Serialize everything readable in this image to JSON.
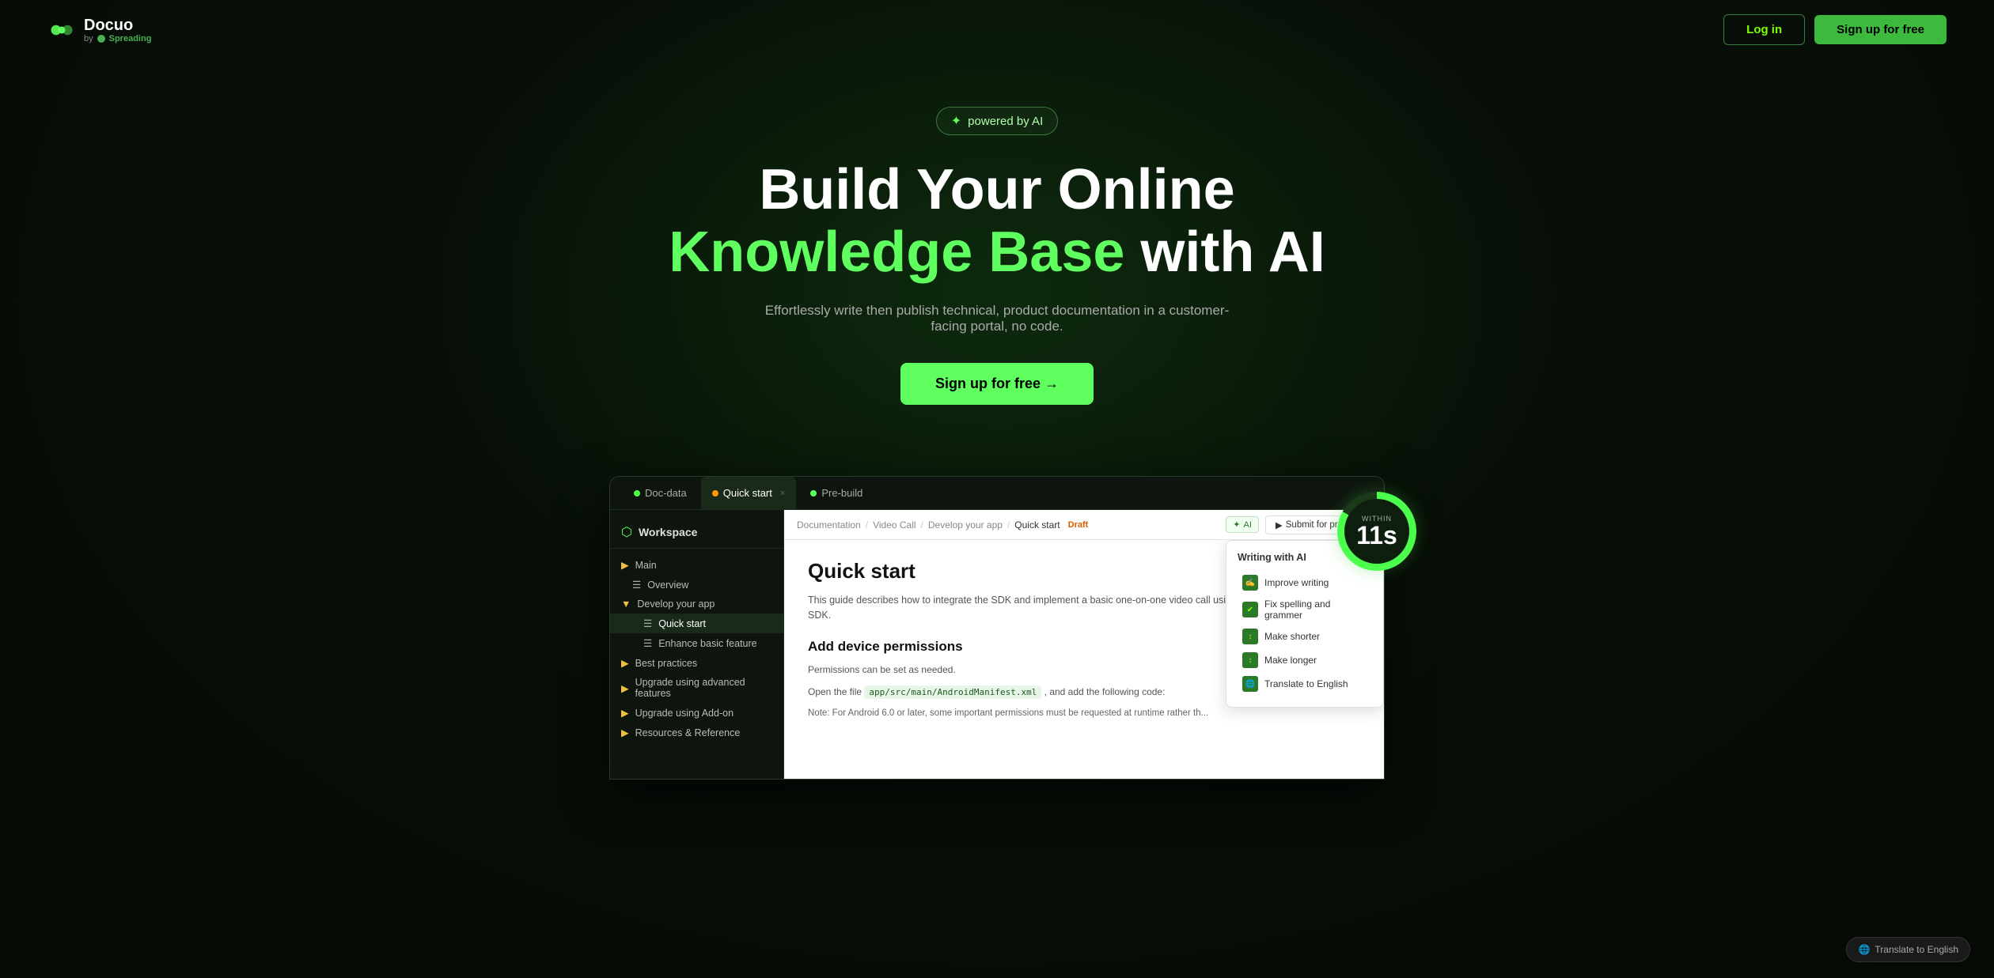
{
  "header": {
    "logo_name": "Docuo",
    "logo_by": "by",
    "logo_spreading": "Spreading",
    "login_label": "Log in",
    "signup_header_label": "Sign up for free"
  },
  "hero": {
    "ai_badge": "powered by AI",
    "title_part1": "Build Your Online ",
    "title_highlight": "Knowledge Base",
    "title_part2": " with AI",
    "subtitle": "Effortlessly write then publish technical, product documentation in a customer-facing portal, no code.",
    "signup_hero_label": "Sign up for free →"
  },
  "timer": {
    "within_label": "WITHIN",
    "seconds": "11s"
  },
  "app": {
    "tabs": [
      {
        "label": "Doc-data",
        "dot_color": "#4cff4c",
        "active": false
      },
      {
        "label": "Quick start",
        "dot_color": "#ff9900",
        "active": true,
        "closable": true
      },
      {
        "label": "Pre-build",
        "dot_color": "#5fff5f",
        "active": false
      }
    ],
    "sidebar": {
      "workspace_label": "Workspace",
      "items": [
        {
          "label": "Main",
          "type": "folder",
          "level": 0
        },
        {
          "label": "Overview",
          "type": "file",
          "level": 1
        },
        {
          "label": "Develop your app",
          "type": "folder",
          "level": 0,
          "expanded": true
        },
        {
          "label": "Quick start",
          "type": "file",
          "level": 2,
          "active": true
        },
        {
          "label": "Enhance basic feature",
          "type": "file",
          "level": 2
        },
        {
          "label": "Best practices",
          "type": "folder",
          "level": 0
        },
        {
          "label": "Upgrade using advanced features",
          "type": "folder",
          "level": 0
        },
        {
          "label": "Upgrade using Add-on",
          "type": "folder",
          "level": 0
        },
        {
          "label": "Resources & Reference",
          "type": "folder",
          "level": 0
        }
      ]
    },
    "breadcrumb": {
      "items": [
        "Documentation",
        "Video Call",
        "Develop your app",
        "Quick start"
      ],
      "draft_label": "Draft"
    },
    "toolbar": {
      "submit_preview_label": "Submit for preview",
      "ai_toolbar_label": "AI"
    },
    "content": {
      "title": "Quick start",
      "description": "This guide describes how to integrate the SDK and implement a basic one-on-one video call using ZEGOCLOUD's Video Call SDK.",
      "section1_title": "Add device permissions",
      "section1_text": "Permissions can be set as needed.",
      "section1_open_file": "Open the file",
      "section1_code": "app/src/main/AndroidManifest.xml",
      "section1_code_suffix": ", and add the following code:",
      "section1_note": "Note: For Android 6.0 or later, some important permissions must be requested at runtime rather th..."
    },
    "ai_panel": {
      "title": "Writing with AI",
      "options": [
        {
          "label": "Improve writing",
          "icon": "✍"
        },
        {
          "label": "Fix spelling and grammer",
          "icon": "✔"
        },
        {
          "label": "Make shorter",
          "icon": "↕"
        },
        {
          "label": "Make longer",
          "icon": "↕"
        },
        {
          "label": "Translate to English",
          "icon": "🌐"
        }
      ]
    }
  },
  "translate_badge": {
    "label": "Translate to English"
  }
}
